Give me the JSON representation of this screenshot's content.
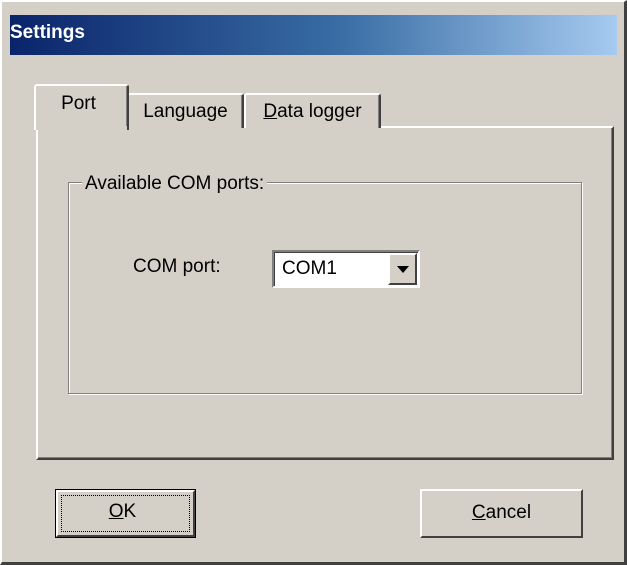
{
  "window": {
    "title": "Settings"
  },
  "tabs": [
    {
      "label": "Port",
      "selected": true
    },
    {
      "label": "Language",
      "selected": false
    },
    {
      "label_mnemonic": "D",
      "label_rest": "ata logger",
      "selected": false
    }
  ],
  "port_tab": {
    "group_label": "Available COM ports:",
    "com_port_label": "COM port:",
    "com_port_value": "COM1"
  },
  "buttons": {
    "ok_mnemonic": "O",
    "ok_rest": "K",
    "cancel_mnemonic": "C",
    "cancel_rest": "ancel"
  },
  "colors": {
    "face": "#d4d0c8",
    "title_gradient_start": "#0a246a",
    "title_gradient_end": "#a6caf0"
  }
}
